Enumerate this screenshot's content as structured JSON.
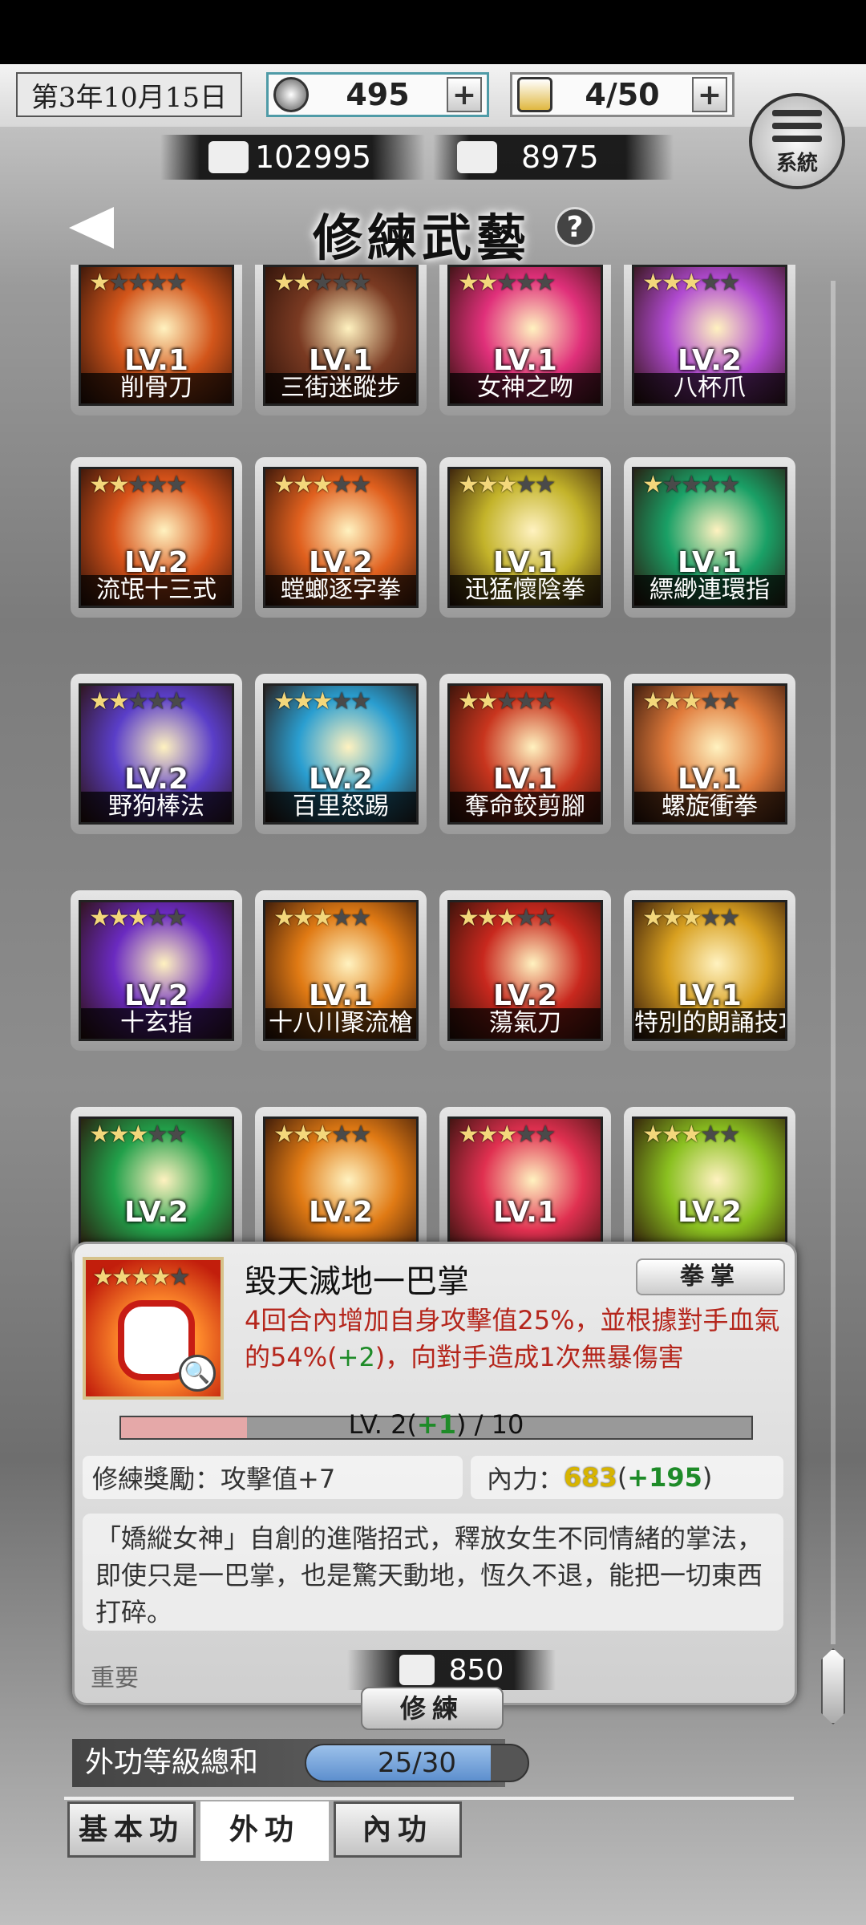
{
  "header": {
    "date": "第3年10月15日",
    "coins": "495",
    "stamina": "4/50",
    "plus": "+",
    "system_label": "系統"
  },
  "money": {
    "silver": "102995",
    "power": "8975"
  },
  "page": {
    "title": "修練武藝",
    "help": "?"
  },
  "skills": [
    {
      "name": "削骨刀",
      "level": "LV.1",
      "stars": 1,
      "max_stars": 5,
      "color": "#d2551a"
    },
    {
      "name": "三街迷蹤步",
      "level": "LV.1",
      "stars": 2,
      "max_stars": 5,
      "color": "#7a3a22"
    },
    {
      "name": "女神之吻",
      "level": "LV.1",
      "stars": 2,
      "max_stars": 5,
      "color": "#e0307a"
    },
    {
      "name": "八杯爪",
      "level": "LV.2",
      "stars": 3,
      "max_stars": 5,
      "color": "#b04ad0"
    },
    {
      "name": "流氓十三式",
      "level": "LV.2",
      "stars": 2,
      "max_stars": 5,
      "color": "#d8531a"
    },
    {
      "name": "螳螂逐字拳",
      "level": "LV.2",
      "stars": 3,
      "max_stars": 5,
      "color": "#e0601e"
    },
    {
      "name": "迅猛懷陰拳",
      "level": "LV.1",
      "stars": 3,
      "max_stars": 5,
      "color": "#c3b32a"
    },
    {
      "name": "縹緲連環指",
      "level": "LV.1",
      "stars": 1,
      "max_stars": 5,
      "color": "#1aa066"
    },
    {
      "name": "野狗棒法",
      "level": "LV.2",
      "stars": 2,
      "max_stars": 5,
      "color": "#5a3ec8"
    },
    {
      "name": "百里怒踢",
      "level": "LV.2",
      "stars": 3,
      "max_stars": 5,
      "color": "#2a9ed0"
    },
    {
      "name": "奪命鉸剪腳",
      "level": "LV.1",
      "stars": 2,
      "max_stars": 5,
      "color": "#c8351e"
    },
    {
      "name": "螺旋衝拳",
      "level": "LV.1",
      "stars": 3,
      "max_stars": 5,
      "color": "#e07a3a"
    },
    {
      "name": "十玄指",
      "level": "LV.2",
      "stars": 3,
      "max_stars": 5,
      "color": "#6a2ac0"
    },
    {
      "name": "十八川聚流槍",
      "level": "LV.1",
      "stars": 3,
      "max_stars": 5,
      "color": "#e07a14"
    },
    {
      "name": "蕩氣刀",
      "level": "LV.2",
      "stars": 3,
      "max_stars": 5,
      "color": "#c8281e"
    },
    {
      "name": "特別的朗誦技巧",
      "level": "LV.1",
      "stars": 3,
      "max_stars": 5,
      "color": "#d8a020"
    },
    {
      "name": "",
      "level": "LV.2",
      "stars": 3,
      "max_stars": 5,
      "color": "#22a04a"
    },
    {
      "name": "",
      "level": "LV.2",
      "stars": 3,
      "max_stars": 5,
      "color": "#e07a14"
    },
    {
      "name": "",
      "level": "LV.1",
      "stars": 3,
      "max_stars": 5,
      "color": "#e03050"
    },
    {
      "name": "",
      "level": "LV.2",
      "stars": 3,
      "max_stars": 5,
      "color": "#8ac020"
    }
  ],
  "detail": {
    "name": "毀天滅地一巴掌",
    "type": "拳掌",
    "stars": 4,
    "max_stars": 5,
    "desc_a": "4回合內增加自身攻擊值25%，並根據對手血氣的54%(",
    "desc_bonus": "+2",
    "desc_b": ")，向對手造成1次無暴傷害",
    "level_a": "LV. 2(",
    "level_bonus": "+1",
    "level_b": ") / 10",
    "level_progress": 0.2,
    "reward_label": "修練獎勵：",
    "reward_value": "攻擊值+7",
    "inner_label": "內力：",
    "inner_value": "683",
    "inner_bonus_a": "(",
    "inner_bonus": "+195",
    "inner_bonus_b": ")",
    "lore": "「嬌縱女神」自創的進階招式，釋放女生不同情緒的掌法，即使只是一巴掌，也是驚天動地，恆久不退，能把一切東西打碎。",
    "important": "重要",
    "cost": "850",
    "train_button": "修練"
  },
  "summary": {
    "label": "外功等級總和",
    "value": "25/30",
    "progress": 0.833
  },
  "tabs": [
    "基本功",
    "外功",
    "內功"
  ],
  "active_tab": 1
}
